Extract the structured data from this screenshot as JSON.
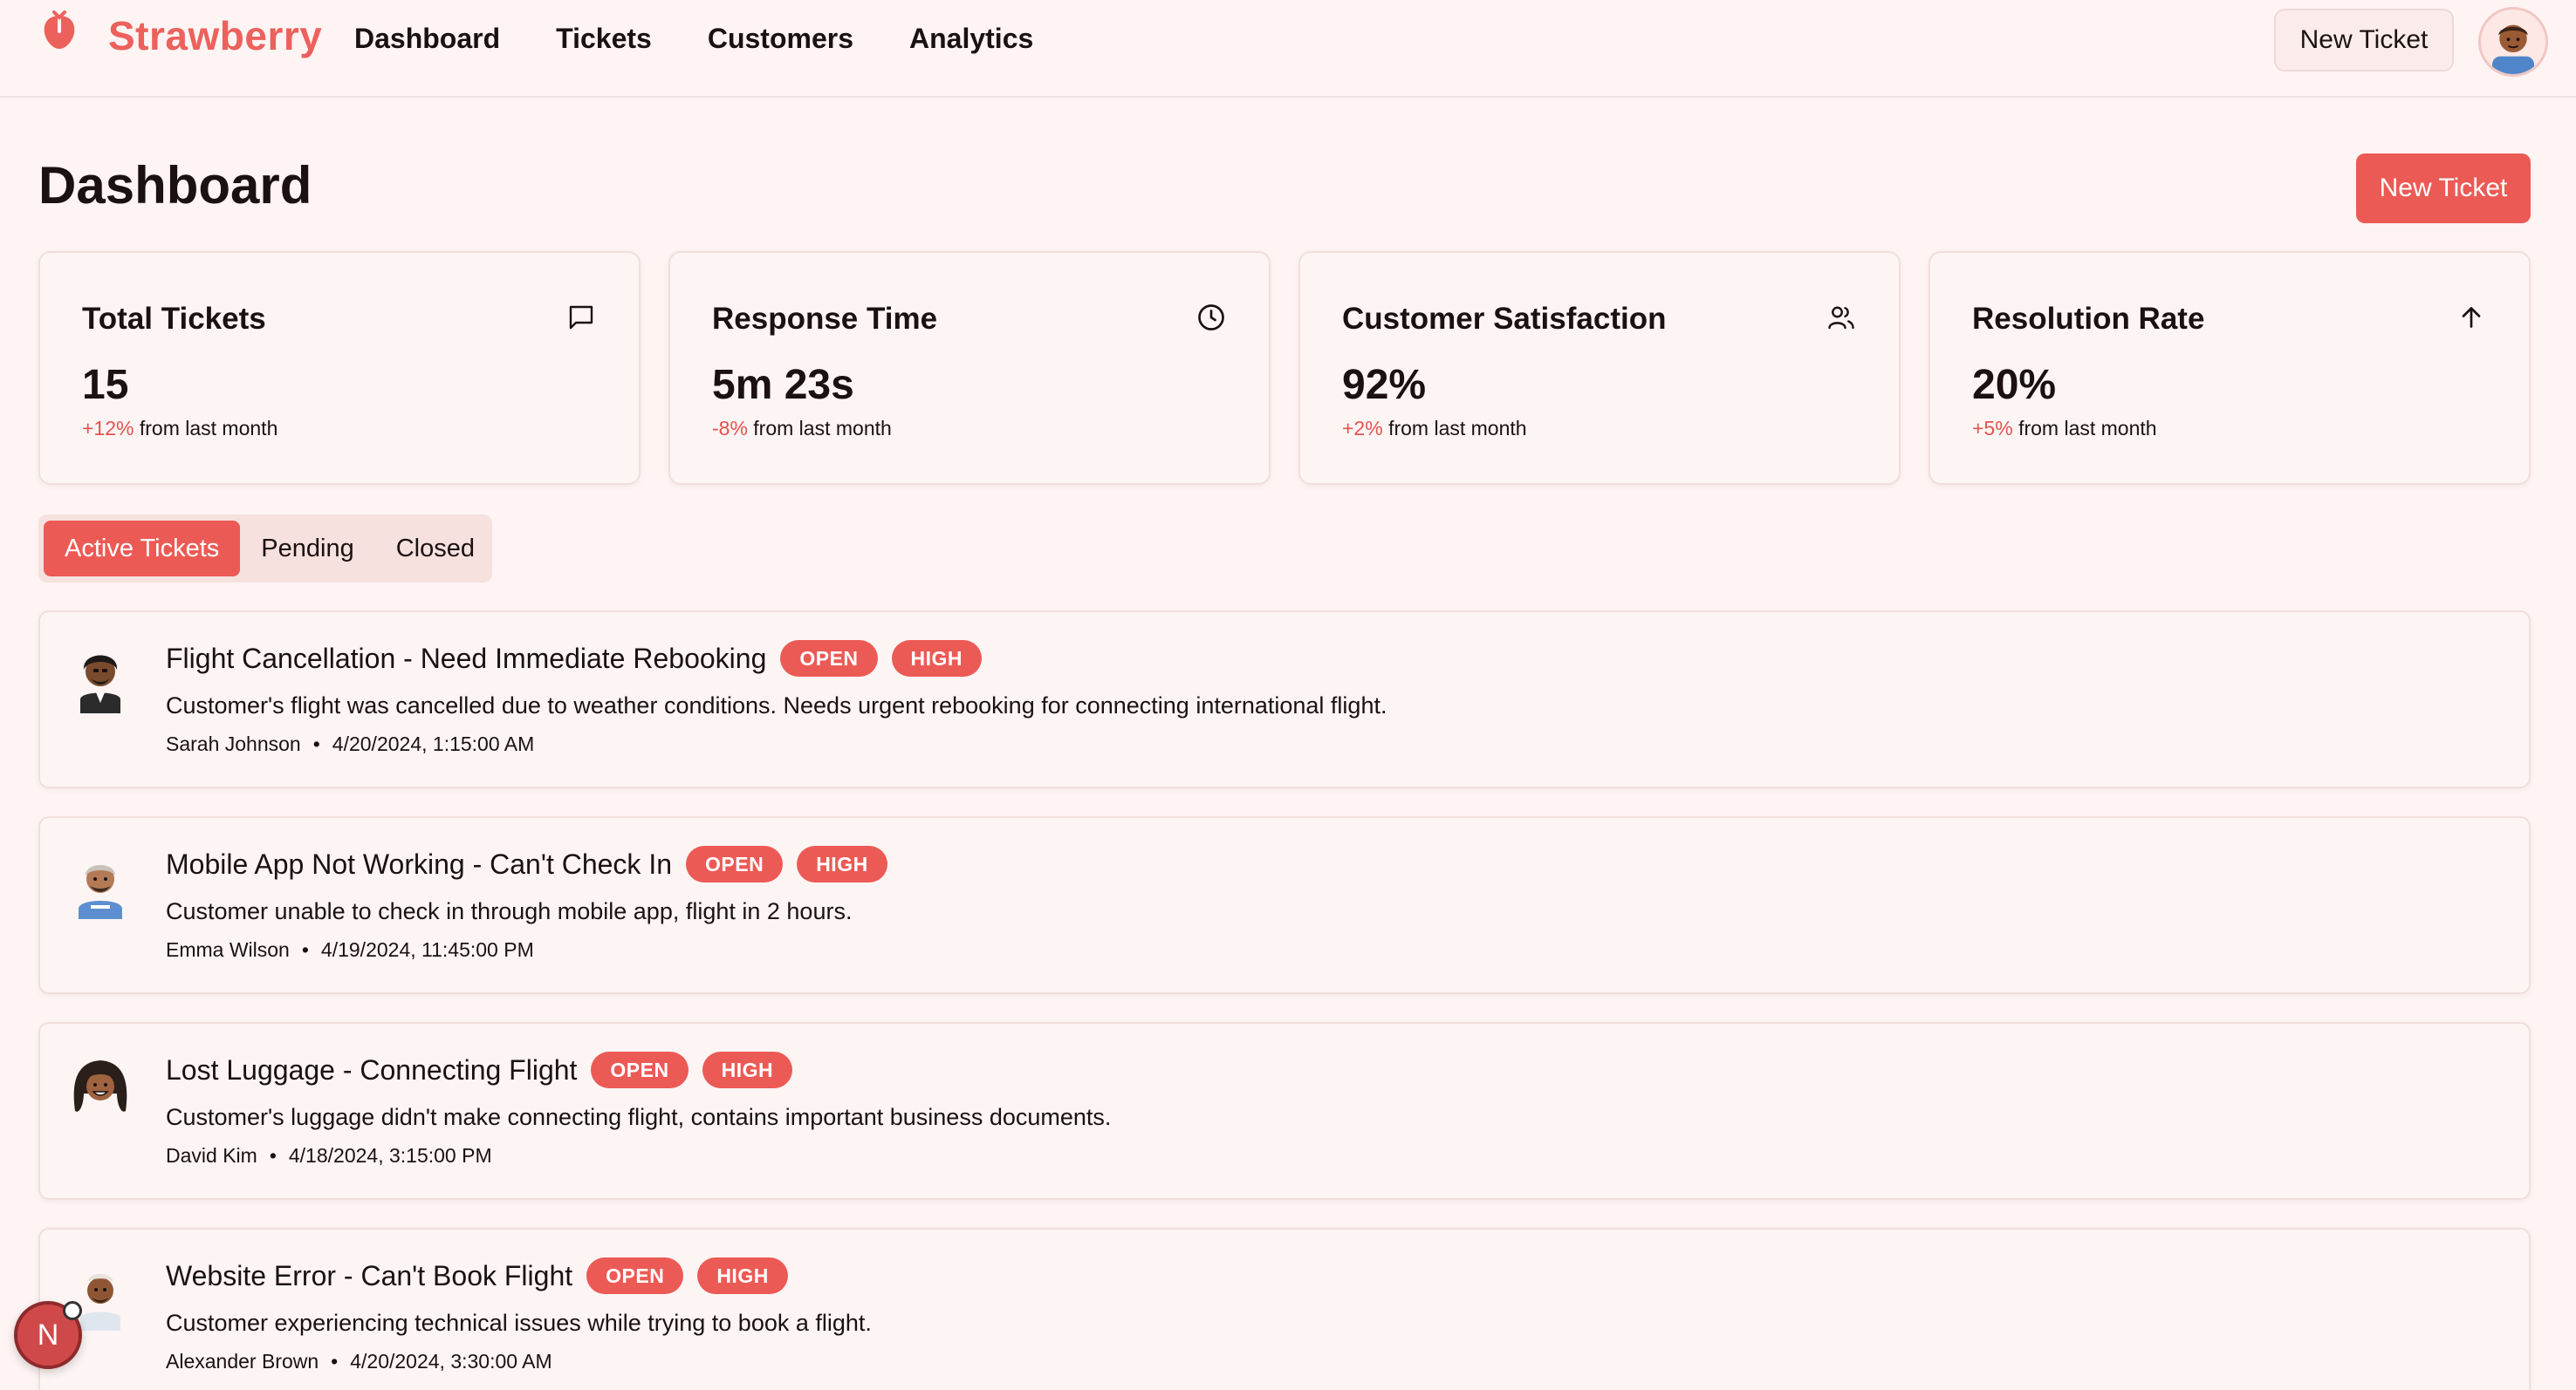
{
  "app": {
    "brand": "Strawberry",
    "brand_color": "#ec615c"
  },
  "nav": {
    "items": [
      {
        "label": "Dashboard"
      },
      {
        "label": "Tickets"
      },
      {
        "label": "Customers"
      },
      {
        "label": "Analytics"
      }
    ]
  },
  "header": {
    "new_ticket_label": "New Ticket",
    "avatar_icon": "user-avatar-icon"
  },
  "page": {
    "title": "Dashboard",
    "new_ticket_label": "New Ticket"
  },
  "stats": [
    {
      "title": "Total Tickets",
      "value": "15",
      "delta": "+12%",
      "suffix": " from last month",
      "icon": "message-square-icon"
    },
    {
      "title": "Response Time",
      "value": "5m 23s",
      "delta": "-8%",
      "suffix": " from last month",
      "icon": "clock-icon"
    },
    {
      "title": "Customer Satisfaction",
      "value": "92%",
      "delta": "+2%",
      "suffix": " from last month",
      "icon": "users-icon"
    },
    {
      "title": "Resolution Rate",
      "value": "20%",
      "delta": "+5%",
      "suffix": " from last month",
      "icon": "arrow-up-icon"
    }
  ],
  "tabs": [
    {
      "label": "Active Tickets",
      "active": true
    },
    {
      "label": "Pending",
      "active": false
    },
    {
      "label": "Closed",
      "active": false
    }
  ],
  "tickets": [
    {
      "title": "Flight Cancellation - Need Immediate Rebooking",
      "status": "OPEN",
      "priority": "HIGH",
      "description": "Customer's flight was cancelled due to weather conditions. Needs urgent rebooking for connecting international flight.",
      "customer": "Sarah Johnson",
      "dot": "•",
      "timestamp": "4/20/2024, 1:15:00 AM"
    },
    {
      "title": "Mobile App Not Working - Can't Check In",
      "status": "OPEN",
      "priority": "HIGH",
      "description": "Customer unable to check in through mobile app, flight in 2 hours.",
      "customer": "Emma Wilson",
      "dot": "•",
      "timestamp": "4/19/2024, 11:45:00 PM"
    },
    {
      "title": "Lost Luggage - Connecting Flight",
      "status": "OPEN",
      "priority": "HIGH",
      "description": "Customer's luggage didn't make connecting flight, contains important business documents.",
      "customer": "David Kim",
      "dot": "•",
      "timestamp": "4/18/2024, 3:15:00 PM"
    },
    {
      "title": "Website Error - Can't Book Flight",
      "status": "OPEN",
      "priority": "HIGH",
      "description": "Customer experiencing technical issues while trying to book a flight.",
      "customer": "Alexander Brown",
      "dot": "•",
      "timestamp": "4/20/2024, 3:30:00 AM"
    }
  ],
  "fab": {
    "label": "N"
  },
  "colors": {
    "accent": "#ec5a55",
    "background": "#fdf4f3",
    "badge": "#ec5a55"
  }
}
